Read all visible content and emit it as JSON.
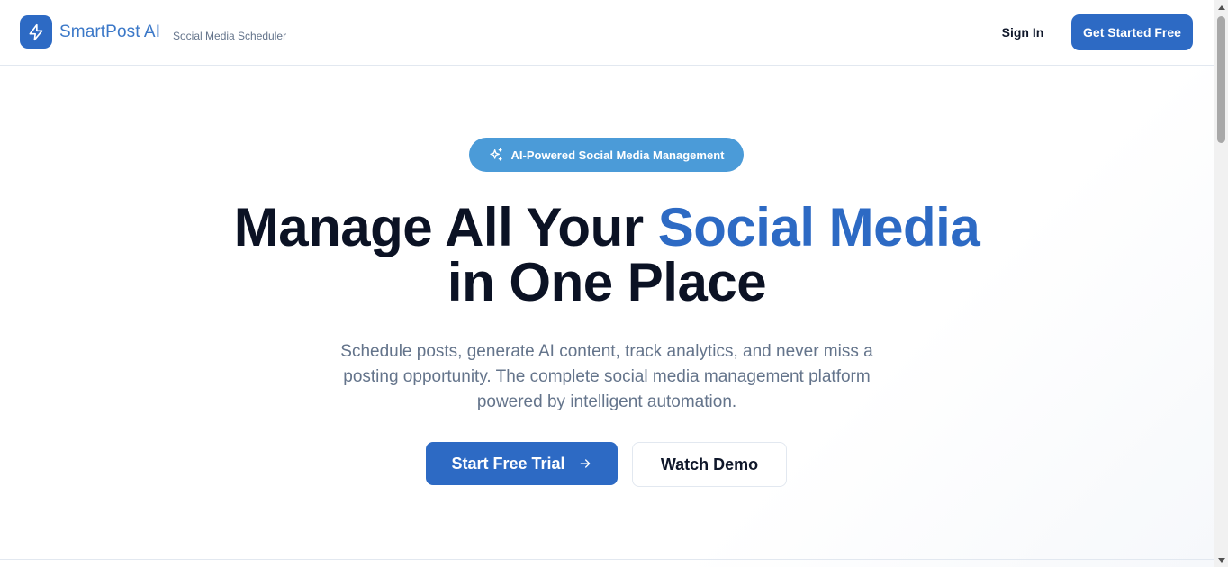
{
  "header": {
    "brand_name": "SmartPost AI",
    "brand_tagline": "Social Media Scheduler",
    "logo_icon": "lightning-icon",
    "sign_in_label": "Sign In",
    "get_started_label": "Get Started Free"
  },
  "hero": {
    "badge_icon": "sparkles-icon",
    "badge_label": "AI-Powered Social Media Management",
    "headline_part1": "Manage All Your ",
    "headline_accent": "Social Media",
    "headline_part2": "in One Place",
    "subtext": "Schedule posts, generate AI content, track analytics, and never miss a posting opportunity. The complete social media management platform powered by intelligent automation.",
    "primary_cta_label": "Start Free Trial",
    "primary_cta_icon": "arrow-right-icon",
    "secondary_cta_label": "Watch Demo"
  },
  "colors": {
    "primary": "#2d6ac4",
    "badge": "#4b9bd8",
    "heading": "#0b1224",
    "muted": "#64748b"
  }
}
